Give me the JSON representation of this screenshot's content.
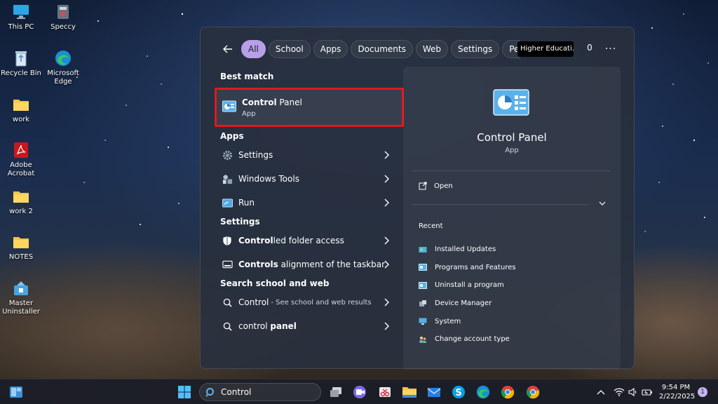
{
  "desktop": {
    "icons": [
      {
        "label": "This PC",
        "icon": "computer-icon"
      },
      {
        "label": "Speccy",
        "icon": "speccy-icon"
      },
      {
        "label": "Recycle Bin",
        "icon": "recycle-bin-icon"
      },
      {
        "label": "Microsoft Edge",
        "icon": "edge-icon"
      },
      {
        "label": "work",
        "icon": "folder-icon"
      },
      {
        "label": "Adobe Acrobat",
        "icon": "acrobat-icon"
      },
      {
        "label": "work 2",
        "icon": "folder-icon"
      },
      {
        "label": "NOTES",
        "icon": "folder-icon"
      },
      {
        "label": "Master Uninstaller",
        "icon": "uninstaller-icon"
      }
    ]
  },
  "search_panel": {
    "filters": [
      "All",
      "School",
      "Apps",
      "Documents",
      "Web",
      "Settings",
      "Pe"
    ],
    "active_filter": "All",
    "org_badge": "Higher Educati...",
    "points": "0",
    "more_label": "···",
    "best_match": {
      "heading": "Best match",
      "title_bold": "Control",
      "title_rest": " Panel",
      "subtitle": "App"
    },
    "apps": {
      "heading": "Apps",
      "items": [
        "Settings",
        "Windows Tools",
        "Run"
      ]
    },
    "settings": {
      "heading": "Settings",
      "items": [
        {
          "bold": "Control",
          "rest": "led folder access"
        },
        {
          "bold": "Controls",
          "rest": " alignment of the taskbar"
        }
      ]
    },
    "web": {
      "heading": "Search school and web",
      "items": [
        {
          "text": "Control",
          "sub": "- See school and web results"
        },
        {
          "text": "control ",
          "bold": "panel"
        }
      ]
    },
    "detail": {
      "title": "Control Panel",
      "subtitle": "App",
      "open_label": "Open",
      "recent_heading": "Recent",
      "recent": [
        "Installed Updates",
        "Programs and Features",
        "Uninstall a program",
        "Device Manager",
        "System",
        "Change account type"
      ]
    }
  },
  "taskbar": {
    "search_value": "Control",
    "time": "9:54 PM",
    "date": "2/22/2025",
    "notification_count": "1"
  }
}
